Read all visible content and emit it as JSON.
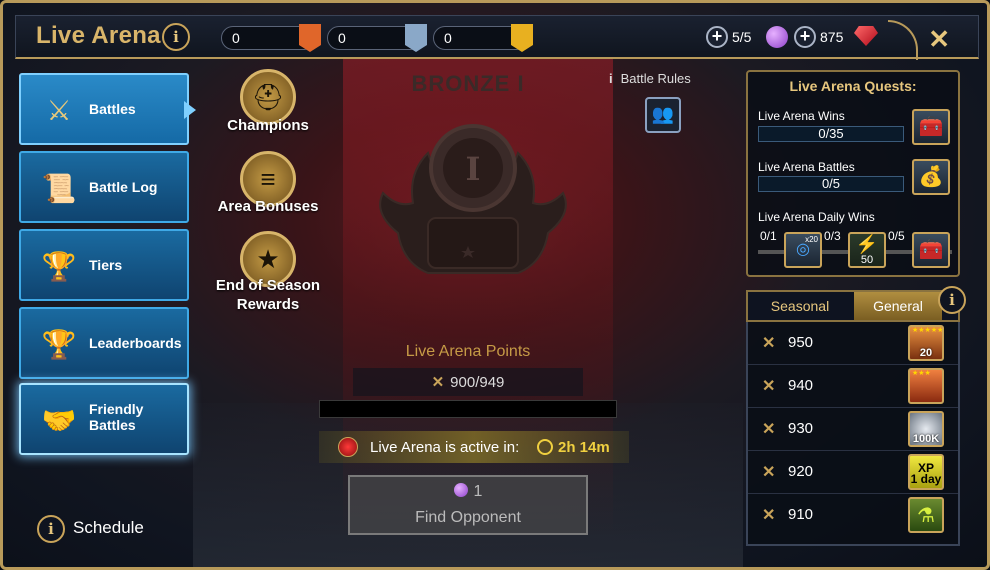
{
  "header": {
    "title": "Live Arena",
    "counters": [
      {
        "value": "0",
        "icon": "bronze-flag-icon",
        "color": "#e0662a"
      },
      {
        "value": "0",
        "icon": "silver-flag-icon",
        "color": "#8aa8c8"
      },
      {
        "value": "0",
        "icon": "gold-flag-icon",
        "color": "#e8b020"
      }
    ],
    "tokens": "5/5",
    "gems": "875",
    "plus": "+",
    "close": "✕"
  },
  "sidebar": {
    "items": [
      {
        "label": "Battles",
        "icon": "crossed-axes-icon",
        "glyph": "⚔"
      },
      {
        "label": "Battle Log",
        "icon": "scroll-icon",
        "glyph": "📜"
      },
      {
        "label": "Tiers",
        "icon": "trophy-icon",
        "glyph": "🏆"
      },
      {
        "label": "Leaderboards",
        "icon": "trophies-icon",
        "glyph": "🏆"
      },
      {
        "label": "Friendly Battles",
        "icon": "handshake-icon",
        "glyph": "🤝"
      }
    ],
    "schedule": "Schedule",
    "info": "i"
  },
  "left_menu": {
    "champions": "Champions",
    "area_bonuses": "Area Bonuses",
    "end_of_season": "End of Season Rewards"
  },
  "center": {
    "rank": "BRONZE I",
    "rank_numeral": "I",
    "battle_rules": "Battle Rules",
    "points_title": "Live Arena Points",
    "points_value": "900/949",
    "points_progress": 0.0,
    "active_label": "Live Arena is active in:",
    "timer": "2h 14m",
    "find_cost": "1",
    "find_label": "Find Opponent"
  },
  "quests": {
    "title": "Live Arena Quests:",
    "items": [
      {
        "name": "Live Arena Wins",
        "progress": "0/35",
        "icon": "chest-icon",
        "glyph": "🧰"
      },
      {
        "name": "Live Arena Battles",
        "progress": "0/5",
        "icon": "potion-bag-icon",
        "glyph": "💰"
      }
    ],
    "daily": {
      "name": "Live Arena Daily Wins",
      "steps": [
        {
          "progress": "0/1",
          "reward": "x20",
          "icon": "arena-token-icon"
        },
        {
          "progress": "0/3",
          "reward": "50",
          "icon": "energy-icon"
        },
        {
          "progress": "0/5",
          "reward": "",
          "icon": "chest-icon"
        }
      ]
    }
  },
  "tabs": {
    "seasonal": "Seasonal",
    "general": "General",
    "info": "i"
  },
  "rewards": [
    {
      "points": "950",
      "item": "20",
      "icon": "champion-shards-icon",
      "color": "#d88030"
    },
    {
      "points": "940",
      "item": "",
      "icon": "chicken-icon",
      "color": "#d0602a"
    },
    {
      "points": "930",
      "item": "100K",
      "icon": "silver-coins-icon",
      "color": "#9aa4b0"
    },
    {
      "points": "920",
      "item": "XP\n1 day",
      "icon": "xp-boost-icon",
      "color": "#d8d020"
    },
    {
      "points": "910",
      "item": "",
      "icon": "potion-icon",
      "color": "#8ac040"
    }
  ]
}
